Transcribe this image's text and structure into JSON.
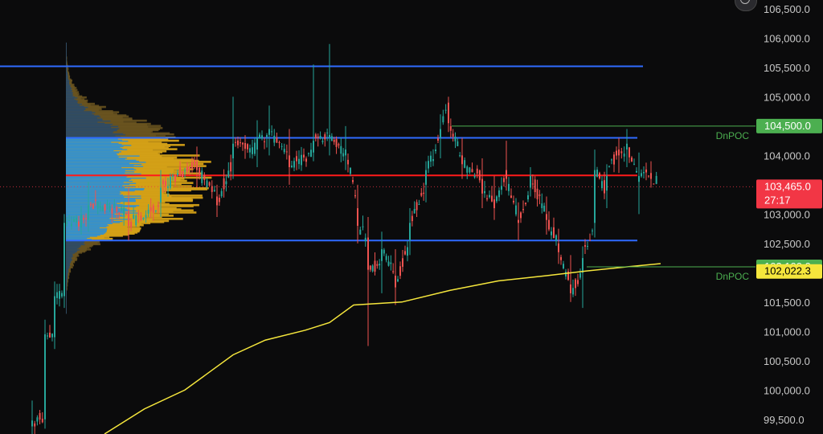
{
  "chart_data": {
    "type": "candlestick",
    "y_axis": {
      "range": [
        99250,
        106650
      ],
      "ticks": [
        99500,
        100000,
        100500,
        101000,
        101500,
        102000,
        102500,
        103000,
        103500,
        104000,
        104500,
        105000,
        105500,
        106000,
        106500
      ],
      "tick_labels": [
        "99,500.0",
        "100,000.0",
        "100,500.0",
        "101,000.0",
        "101,500.0",
        "102,000.0",
        "102,500.0",
        "103,000.0",
        "103,500.0",
        "104,000.0",
        "104,500.0",
        "105,000.0",
        "105,500.0",
        "106,000.0",
        "106,500.0"
      ]
    },
    "price_tags": [
      {
        "label": "104,500.0",
        "value": 104500,
        "bg": "#4caf50",
        "fg": "#ffffff"
      },
      {
        "label": "103,465.0",
        "sublabel": "27:17",
        "value": 103465,
        "bg": "#f23645",
        "fg": "#ffffff"
      },
      {
        "label": "102,100.0",
        "value": 102100,
        "bg": "#4caf50",
        "fg": "#ffffff"
      },
      {
        "label": "102,022.3",
        "value": 102022.3,
        "bg": "#f5e63c",
        "fg": "#000000"
      }
    ],
    "dnpoc_labels": [
      {
        "text": "DnPOC",
        "value": 104500
      },
      {
        "text": "DnPOC",
        "value": 102100
      }
    ],
    "horizontal_levels": [
      {
        "name": "value-area-high-extended",
        "value": 105520,
        "color": "#2f6bff"
      },
      {
        "name": "value-area-high",
        "value": 104300,
        "color": "#2f6bff"
      },
      {
        "name": "point-of-control",
        "value": 103660,
        "color": "#ff1a1a"
      },
      {
        "name": "value-area-low",
        "value": 102550,
        "color": "#2f6bff"
      }
    ],
    "current_price": 103465,
    "colors": {
      "up": "#26a69a",
      "down": "#ef5350",
      "vwap": "#f5e63c",
      "profile_in_va": "#2a8fd8",
      "profile_in_va_outer": "#d4a017",
      "profile_out_va": "#2a4a6a",
      "profile_out_va_outer": "#6b5520"
    },
    "vwap": [
      [
        130,
        99250
      ],
      [
        180,
        99680
      ],
      [
        230,
        100000
      ],
      [
        290,
        100600
      ],
      [
        330,
        100850
      ],
      [
        380,
        101020
      ],
      [
        410,
        101150
      ],
      [
        440,
        101450
      ],
      [
        500,
        101500
      ],
      [
        560,
        101700
      ],
      [
        620,
        101860
      ],
      [
        680,
        101950
      ],
      [
        730,
        102030
      ],
      [
        780,
        102100
      ],
      [
        822,
        102155
      ]
    ],
    "candles": [
      [
        40,
        99380,
        99820,
        99200,
        99480
      ],
      [
        56,
        99500,
        101200,
        99340,
        100950
      ],
      [
        68,
        100900,
        101850,
        100700,
        101600
      ],
      [
        80,
        101600,
        103000,
        101400,
        102850
      ],
      [
        110,
        102900,
        103550,
        102700,
        103150
      ],
      [
        160,
        103050,
        103450,
        102550,
        102800
      ],
      [
        200,
        103200,
        103750,
        102950,
        103450
      ],
      [
        245,
        103900,
        104150,
        103450,
        103750
      ],
      [
        270,
        103300,
        103500,
        102950,
        103150
      ],
      [
        290,
        103950,
        105000,
        103600,
        104200
      ],
      [
        320,
        104100,
        104600,
        103800,
        104300
      ],
      [
        335,
        104350,
        104850,
        104000,
        104450
      ],
      [
        360,
        104000,
        104450,
        103500,
        103800
      ],
      [
        390,
        104050,
        105550,
        103900,
        104250
      ],
      [
        410,
        104300,
        105900,
        104000,
        104350
      ],
      [
        430,
        104000,
        104500,
        103750,
        104100
      ],
      [
        445,
        103100,
        103500,
        102500,
        102800
      ],
      [
        458,
        102600,
        102950,
        100750,
        102050
      ],
      [
        475,
        102200,
        102700,
        101650,
        102400
      ],
      [
        492,
        101950,
        102400,
        101450,
        101750
      ],
      [
        510,
        102550,
        103100,
        102300,
        102850
      ],
      [
        530,
        103500,
        103900,
        103200,
        103750
      ],
      [
        548,
        104300,
        104700,
        103950,
        104450
      ],
      [
        558,
        104900,
        105000,
        104400,
        104550
      ],
      [
        575,
        104000,
        104300,
        103600,
        103850
      ],
      [
        600,
        103600,
        103950,
        103100,
        103350
      ],
      [
        615,
        103250,
        103650,
        102900,
        103100
      ],
      [
        630,
        103750,
        104250,
        103400,
        103600
      ],
      [
        645,
        102900,
        103200,
        102550,
        102850
      ],
      [
        660,
        103450,
        103800,
        103300,
        103650
      ],
      [
        680,
        103000,
        103300,
        102650,
        102900
      ],
      [
        695,
        102500,
        102750,
        102150,
        102350
      ],
      [
        710,
        101800,
        102300,
        101500,
        101650
      ],
      [
        725,
        102000,
        102450,
        101400,
        102250
      ],
      [
        740,
        102850,
        104100,
        102600,
        103750
      ],
      [
        755,
        103400,
        103850,
        103100,
        103650
      ],
      [
        770,
        104100,
        104300,
        103700,
        104000
      ],
      [
        780,
        104100,
        104450,
        103800,
        104200
      ],
      [
        795,
        103550,
        104050,
        103000,
        103650
      ],
      [
        810,
        103700,
        103900,
        103450,
        103600
      ],
      [
        820,
        103550,
        103700,
        103450,
        103465
      ]
    ]
  }
}
